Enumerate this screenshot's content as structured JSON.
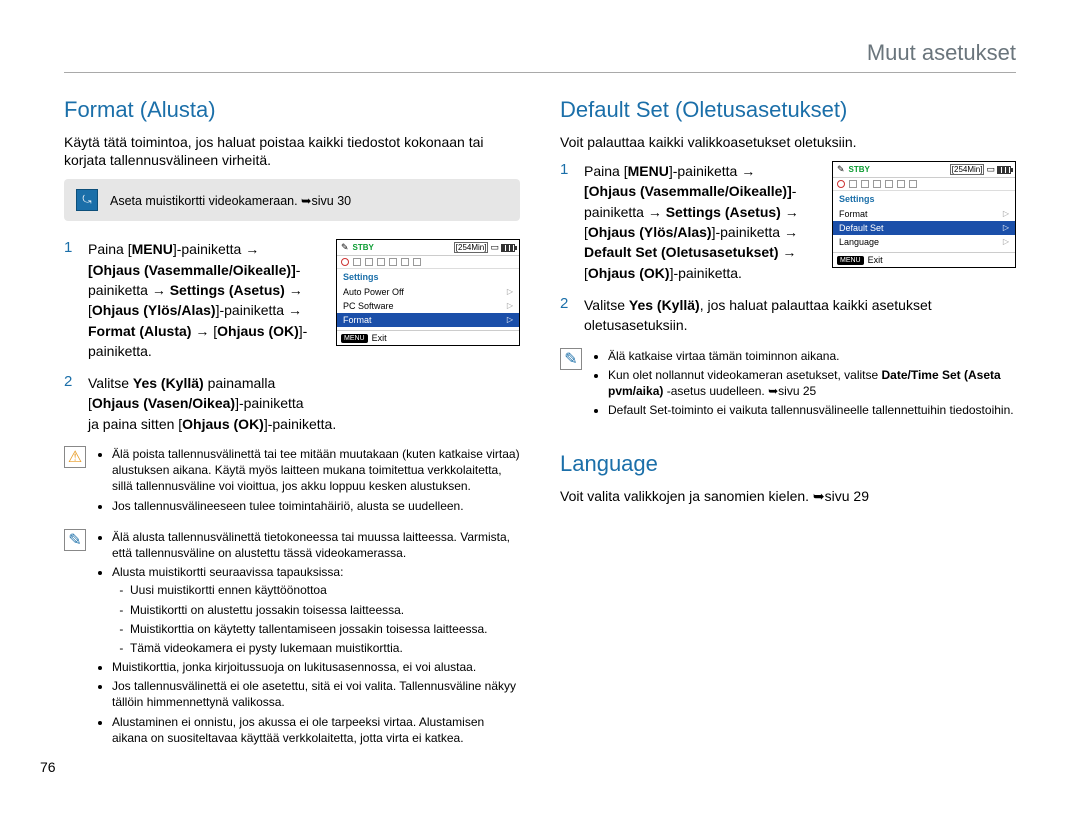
{
  "header": {
    "title": "Muut asetukset"
  },
  "page_number": "76",
  "left": {
    "h2": "Format (Alusta)",
    "intro": "Käytä tätä toimintoa, jos haluat poistaa kaikki tiedostot kokonaan tai korjata tallennusvälineen virheitä.",
    "callout_icon": "⤿",
    "callout_text": "Aseta muistikortti videokameraan. ➥sivu 30",
    "step1_num": "1",
    "step1_l1_a": "Paina [",
    "step1_l1_b": "MENU",
    "step1_l1_c": "]-painiketta → ",
    "step1_l2": "[Ohjaus (Vasemmalle/Oikealle)]",
    "step1_l2b": "-",
    "step1_l3_a": "painiketta → ",
    "step1_l3_b": "Settings (Asetus)",
    "step1_l3_c": " → ",
    "step1_l4_a": "[",
    "step1_l4_b": "Ohjaus (Ylös/Alas)",
    "step1_l4_c": "]-painiketta → ",
    "step1_l5_a": "Format (Alusta)",
    "step1_l5_b": " → [",
    "step1_l5_c": "Ohjaus (OK)",
    "step1_l5_d": "]-",
    "step1_l6": "painiketta.",
    "step2_num": "2",
    "step2_l1_a": "Valitse ",
    "step2_l1_b": "Yes (Kyllä)",
    "step2_l1_c": " painamalla",
    "step2_l2_a": "[",
    "step2_l2_b": "Ohjaus (Vasen/Oikea)",
    "step2_l2_c": "]-painiketta",
    "step2_l3_a": "ja paina sitten [",
    "step2_l3_b": "Ohjaus (OK)",
    "step2_l3_c": "]-painiketta.",
    "warn1_li1": "Älä poista tallennusvälinettä tai tee mitään muutakaan (kuten katkaise virtaa) alustuksen aikana. Käytä myös laitteen mukana toimitettua verkkolaitetta, sillä tallennusväline voi vioittua, jos akku loppuu kesken alustuksen.",
    "warn1_li2": "Jos tallennusvälineeseen tulee toimintahäiriö, alusta se uudelleen.",
    "info_li1": "Älä alusta tallennusvälinettä tietokoneessa tai muussa laitteessa. Varmista, että tallennusväline on alustettu tässä videokamerassa.",
    "info_li2": "Alusta muistikortti seuraavissa tapauksissa:",
    "info_li2_s1": "Uusi muistikortti ennen käyttöönottoa",
    "info_li2_s2": "Muistikortti on alustettu jossakin toisessa laitteessa.",
    "info_li2_s3": "Muistikorttia on käytetty tallentamiseen jossakin toisessa laitteessa.",
    "info_li2_s4": "Tämä videokamera ei pysty lukemaan muistikorttia.",
    "info_li3": "Muistikorttia, jonka kirjoitussuoja on lukitusasennossa, ei voi alustaa.",
    "info_li4": "Jos tallennusvälinettä ei ole asetettu, sitä ei voi valita. Tallennusväline näkyy tällöin himmennettynä valikossa.",
    "info_li5": "Alustaminen ei onnistu, jos akussa ei ole tarpeeksi virtaa. Alustamisen aikana on suositeltavaa käyttää verkkolaitetta, jotta virta ei katkea.",
    "lcd": {
      "stby": "STBY",
      "time": "[254Min]",
      "settings_label": "Settings",
      "items": [
        "Auto Power Off",
        "PC Software",
        "Format"
      ],
      "selected_index": 2,
      "menu_label": "MENU",
      "exit_label": "Exit"
    }
  },
  "right": {
    "h2_default": "Default Set (Oletusasetukset)",
    "default_intro": "Voit palauttaa kaikki valikkoasetukset oletuksiin.",
    "step1_num": "1",
    "step1_l1_a": "Paina [",
    "step1_l1_b": "MENU",
    "step1_l1_c": "]-painiketta → ",
    "step1_l2": "[Ohjaus (Vasemmalle/Oikealle)]",
    "step1_l2b": "-",
    "step1_l3_a": "painiketta → ",
    "step1_l3_b": "Settings (Asetus)",
    "step1_l3_c": " → ",
    "step1_l4_a": "[",
    "step1_l4_b": "Ohjaus (Ylös/Alas)",
    "step1_l4_c": "]-painiketta → ",
    "step1_l5_a": "Default Set (Oletusasetukset)",
    "step1_l5_b": " → ",
    "step1_l6_a": "[",
    "step1_l6_b": "Ohjaus (OK)",
    "step1_l6_c": "]-painiketta.",
    "step2_num": "2",
    "step2_l1_a": "Valitse ",
    "step2_l1_b": "Yes (Kyllä)",
    "step2_l1_c": ", jos haluat palauttaa kaikki asetukset oletusasetuksiin.",
    "info_li1": "Älä katkaise virtaa tämän toiminnon aikana.",
    "info_li2_a": "Kun olet nollannut videokameran asetukset, valitse ",
    "info_li2_b": "Date/Time Set (Aseta pvm/aika)",
    "info_li2_c": " -asetus uudelleen. ➥sivu 25",
    "info_li3": "Default Set-toiminto ei vaikuta tallennusvälineelle tallennettuihin tiedostoihin.",
    "h2_lang": "Language",
    "lang_text": "Voit valita valikkojen ja sanomien kielen. ➥sivu 29",
    "lcd": {
      "stby": "STBY",
      "time": "[254Min]",
      "settings_label": "Settings",
      "items": [
        "Format",
        "Default Set",
        "Language"
      ],
      "selected_index": 1,
      "menu_label": "MENU",
      "exit_label": "Exit"
    }
  }
}
